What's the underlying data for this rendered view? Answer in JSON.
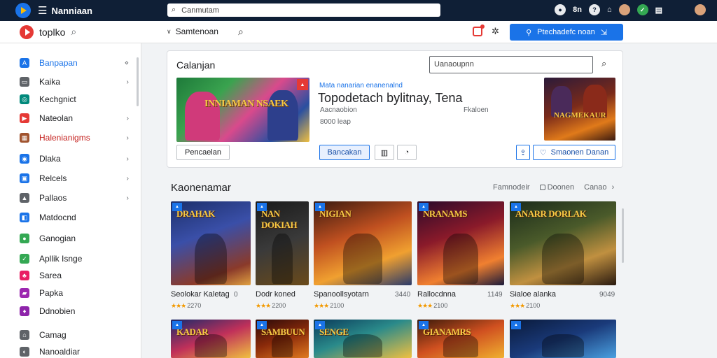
{
  "topbar": {
    "title": "Nanniaan",
    "search_text": "Canmutam",
    "indicator": "8n"
  },
  "header": {
    "brand": "toplko",
    "dropdown_label": "Samtenoan",
    "cta_label": "Ptechadefc noan"
  },
  "sidebar": {
    "items": [
      {
        "label": "Banpapan",
        "icon_color": "#1a73e8",
        "icon": "A"
      },
      {
        "label": "Kaika",
        "icon_color": "#5f6368",
        "icon": "▭"
      },
      {
        "label": "Kechgnict",
        "icon_color": "#00897b",
        "icon": "◎"
      },
      {
        "label": "Nateolan",
        "icon_color": "#e53935",
        "icon": "▶"
      },
      {
        "label": "Halenianigms",
        "icon_color": "#a0522d",
        "icon": "▦"
      },
      {
        "label": "Dlaka",
        "icon_color": "#1a73e8",
        "icon": "◉"
      },
      {
        "label": "Relcels",
        "icon_color": "#1a73e8",
        "icon": "▣"
      },
      {
        "label": "Pallaos",
        "icon_color": "#5f6368",
        "icon": "▲"
      },
      {
        "label": "Matdocnd",
        "icon_color": "#1a73e8",
        "icon": "◧"
      },
      {
        "label": "Ganogian",
        "icon_color": "#34a853",
        "icon": "●"
      },
      {
        "label": "Apllik Isnge",
        "icon_color": "#34a853",
        "icon": "✓"
      },
      {
        "label": "Sarea",
        "icon_color": "#e91e63",
        "icon": "♣"
      },
      {
        "label": "Papka",
        "icon_color": "#9c27b0",
        "icon": "▰"
      },
      {
        "label": "Ddnobien",
        "icon_color": "#8e24aa",
        "icon": "♦"
      },
      {
        "label": "Camag",
        "icon_color": "#5f6368",
        "icon": "⌂"
      },
      {
        "label": "Nanoaldiar",
        "icon_color": "#5f6368",
        "icon": "◐"
      }
    ]
  },
  "featured": {
    "title": "Calanjan",
    "search_value": "Uanaoupnn",
    "subtitle": "Mata nanarian enanenalnd",
    "headline": "Topodetach bylitnay, Tena",
    "meta1": "Aacnaobion",
    "meta2": "8000 leap",
    "meta3": "Fkaloen",
    "hero_logo": "INNIAMAN NSAEK",
    "side_logo": "NAGMEKAUR",
    "secondary_button": "Pencaelan",
    "primary_button": "Bancakan",
    "outline_button": "Smaonen Danan"
  },
  "section": {
    "title": "Kaonenamar",
    "link1": "Famnodeir",
    "link2": "Doonen",
    "link3": "Canao"
  },
  "tiles": [
    {
      "name": "Seolokar Kaletag",
      "num": "0",
      "rating": "2270",
      "logo": "DRAHAK"
    },
    {
      "name": "Dodr koned",
      "num": "",
      "rating": "2200",
      "logo": "NAN DOKIAH"
    },
    {
      "name": "Spanoollsyotarn",
      "num": "3440",
      "rating": "2100",
      "logo": "NIGIAN"
    },
    {
      "name": "Rallocdnna",
      "num": "1149",
      "rating": "2100",
      "logo": "NRANAMS"
    },
    {
      "name": "Sialoe alanka",
      "num": "9049",
      "rating": "2100",
      "logo": "ANARR DORLAK"
    },
    {
      "name": "",
      "num": "",
      "rating": "",
      "logo": "KADAR"
    },
    {
      "name": "",
      "num": "",
      "rating": "",
      "logo": "SAMBUUN"
    },
    {
      "name": "",
      "num": "",
      "rating": "",
      "logo": "SENGE"
    },
    {
      "name": "",
      "num": "",
      "rating": "",
      "logo": "GIANAMRS"
    },
    {
      "name": "",
      "num": "",
      "rating": "",
      "logo": ""
    }
  ]
}
